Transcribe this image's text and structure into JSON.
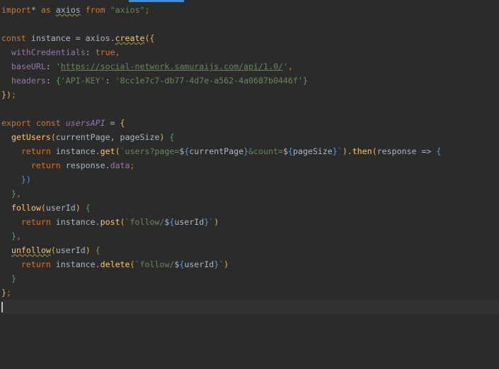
{
  "editor": {
    "cursor_line": 22,
    "lines": [
      [
        [
          "k",
          "import"
        ],
        [
          "",
          "* "
        ],
        [
          "k",
          "as "
        ],
        [
          "w",
          "axios"
        ],
        [
          "k",
          " from "
        ],
        [
          "s",
          "\"axios\""
        ],
        [
          "k",
          ";"
        ]
      ],
      [],
      [
        [
          "k",
          "const "
        ],
        [
          "",
          "instance = axios."
        ],
        [
          "w f",
          "create"
        ],
        [
          "b1",
          "({"
        ]
      ],
      [
        [
          "",
          "  "
        ],
        [
          "p",
          "withCredentials"
        ],
        [
          "",
          ": "
        ],
        [
          "k",
          "true,"
        ]
      ],
      [
        [
          "",
          "  "
        ],
        [
          "p",
          "baseURL"
        ],
        [
          "",
          ": "
        ],
        [
          "s",
          "'"
        ],
        [
          "s u",
          "https://social-network.samuraijs.com/api/1.0/"
        ],
        [
          "s",
          "'"
        ],
        [
          "k",
          ","
        ]
      ],
      [
        [
          "",
          "  "
        ],
        [
          "p",
          "headers"
        ],
        [
          "",
          ": "
        ],
        [
          "b2",
          "{"
        ],
        [
          "s",
          "'API-KEY'"
        ],
        [
          "",
          ": "
        ],
        [
          "s",
          "'8cc1e7c7-db77-4d7e-a562-4a0687b0446f'"
        ],
        [
          "b2",
          "}"
        ]
      ],
      [
        [
          "b1",
          "})"
        ],
        [
          "k",
          ";"
        ]
      ],
      [],
      [
        [
          "k",
          "export const "
        ],
        [
          "pi",
          "usersAPI"
        ],
        [
          "",
          " = "
        ],
        [
          "b1",
          "{"
        ]
      ],
      [
        [
          "",
          "  "
        ],
        [
          "f",
          "getUsers"
        ],
        [
          "b1",
          "("
        ],
        [
          "",
          "currentPage, pageSize"
        ],
        [
          "b1",
          ")"
        ],
        [
          "",
          " "
        ],
        [
          "b2",
          "{"
        ]
      ],
      [
        [
          "",
          "    "
        ],
        [
          "k",
          "return "
        ],
        [
          "",
          "instance."
        ],
        [
          "f",
          "get"
        ],
        [
          "b1",
          "("
        ],
        [
          "s",
          "`users?page="
        ],
        [
          "",
          "$"
        ],
        [
          "b3",
          "{"
        ],
        [
          "",
          "currentPage"
        ],
        [
          "b3",
          "}"
        ],
        [
          "s",
          "&count="
        ],
        [
          "",
          "$"
        ],
        [
          "b3",
          "{"
        ],
        [
          "",
          "pageSize"
        ],
        [
          "b3",
          "}"
        ],
        [
          "s",
          "`"
        ],
        [
          "b1",
          ")"
        ],
        [
          "",
          "."
        ],
        [
          "f",
          "then"
        ],
        [
          "b1",
          "("
        ],
        [
          "",
          "response => "
        ],
        [
          "b3",
          "{"
        ]
      ],
      [
        [
          "",
          "      "
        ],
        [
          "k",
          "return "
        ],
        [
          "",
          "response."
        ],
        [
          "p",
          "data"
        ],
        [
          "k",
          ";"
        ]
      ],
      [
        [
          "",
          "    "
        ],
        [
          "b3",
          "})"
        ]
      ],
      [
        [
          "",
          "  "
        ],
        [
          "b2",
          "}"
        ],
        [
          "k",
          ","
        ]
      ],
      [
        [
          "",
          "  "
        ],
        [
          "f",
          "follow"
        ],
        [
          "b1",
          "("
        ],
        [
          "",
          "userId"
        ],
        [
          "b1",
          ")"
        ],
        [
          "",
          " "
        ],
        [
          "b2",
          "{"
        ]
      ],
      [
        [
          "",
          "    "
        ],
        [
          "k",
          "return "
        ],
        [
          "",
          "instance."
        ],
        [
          "f",
          "post"
        ],
        [
          "b1",
          "("
        ],
        [
          "s",
          "`follow/"
        ],
        [
          "",
          "$"
        ],
        [
          "b3",
          "{"
        ],
        [
          "",
          "userId"
        ],
        [
          "b3",
          "}"
        ],
        [
          "s",
          "`"
        ],
        [
          "b1",
          ")"
        ]
      ],
      [
        [
          "",
          "  "
        ],
        [
          "b2",
          "}"
        ],
        [
          "k",
          ","
        ]
      ],
      [
        [
          "",
          "  "
        ],
        [
          "w f",
          "unfollow"
        ],
        [
          "b1",
          "("
        ],
        [
          "",
          "userId"
        ],
        [
          "b1",
          ")"
        ],
        [
          "",
          " "
        ],
        [
          "b2",
          "{"
        ]
      ],
      [
        [
          "",
          "    "
        ],
        [
          "k",
          "return "
        ],
        [
          "",
          "instance."
        ],
        [
          "f",
          "delete"
        ],
        [
          "b1",
          "("
        ],
        [
          "s",
          "`follow/"
        ],
        [
          "",
          "$"
        ],
        [
          "b3",
          "{"
        ],
        [
          "",
          "userId"
        ],
        [
          "b3",
          "}"
        ],
        [
          "s",
          "`"
        ],
        [
          "b1",
          ")"
        ]
      ],
      [
        [
          "",
          "  "
        ],
        [
          "b2",
          "}"
        ]
      ],
      [
        [
          "b1",
          "}"
        ],
        [
          "k",
          ";"
        ]
      ],
      []
    ]
  }
}
